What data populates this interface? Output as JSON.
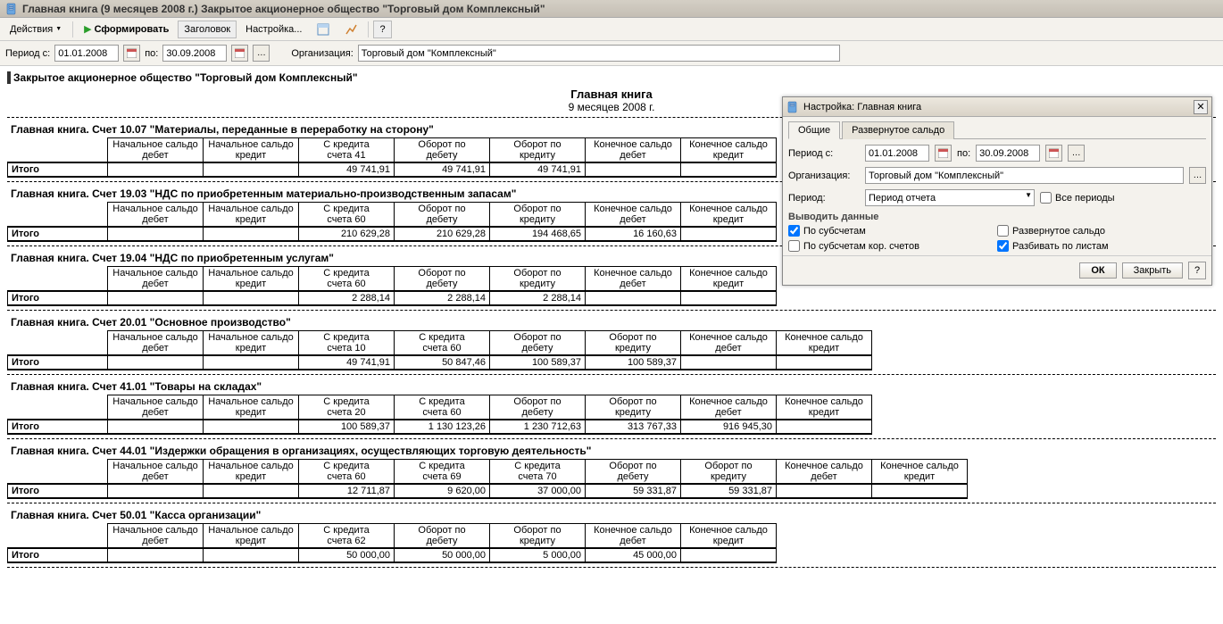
{
  "window": {
    "title": "Главная книга (9 месяцев 2008 г.) Закрытое акционерное общество \"Торговый дом Комплексный\""
  },
  "toolbar": {
    "actions": "Действия",
    "generate": "Сформировать",
    "header": "Заголовок",
    "settings": "Настройка...",
    "help": "?"
  },
  "filter": {
    "period_from_lbl": "Период с:",
    "period_from": "01.01.2008",
    "period_to_lbl": "по:",
    "period_to": "30.09.2008",
    "org_lbl": "Организация:",
    "org": "Торговый дом \"Комплексный\""
  },
  "report": {
    "org_header": "Закрытое акционерное общество \"Торговый дом Комплексный\"",
    "title": "Главная книга",
    "subtitle": "9 месяцев 2008 г.",
    "itog": "Итого",
    "sections": [
      {
        "title": "Главная книга. Счет 10.07 \"Материалы, переданные в переработку на сторону\"",
        "headers": [
          "Начальное сальдо дебет",
          "Начальное сальдо кредит",
          "С кредита счета 41",
          "Оборот по дебету",
          "Оборот по кредиту",
          "Конечное сальдо дебет",
          "Конечное сальдо кредит"
        ],
        "values": [
          "",
          "",
          "49 741,91",
          "49 741,91",
          "49 741,91",
          "",
          ""
        ]
      },
      {
        "title": "Главная книга. Счет 19.03 \"НДС по приобретенным материально-производственным запасам\"",
        "headers": [
          "Начальное сальдо дебет",
          "Начальное сальдо кредит",
          "С кредита счета 60",
          "Оборот по дебету",
          "Оборот по кредиту",
          "Конечное сальдо дебет",
          "Конечное сальдо кредит"
        ],
        "values": [
          "",
          "",
          "210 629,28",
          "210 629,28",
          "194 468,65",
          "16 160,63",
          ""
        ]
      },
      {
        "title": "Главная книга. Счет 19.04 \"НДС по приобретенным услугам\"",
        "headers": [
          "Начальное сальдо дебет",
          "Начальное сальдо кредит",
          "С кредита счета 60",
          "Оборот по дебету",
          "Оборот по кредиту",
          "Конечное сальдо дебет",
          "Конечное сальдо кредит"
        ],
        "values": [
          "",
          "",
          "2 288,14",
          "2 288,14",
          "2 288,14",
          "",
          ""
        ]
      },
      {
        "title": "Главная книга. Счет 20.01 \"Основное производство\"",
        "headers": [
          "Начальное сальдо дебет",
          "Начальное сальдо кредит",
          "С кредита счета 10",
          "С кредита счета 60",
          "Оборот по дебету",
          "Оборот по кредиту",
          "Конечное сальдо дебет",
          "Конечное сальдо кредит"
        ],
        "values": [
          "",
          "",
          "49 741,91",
          "50 847,46",
          "100 589,37",
          "100 589,37",
          "",
          ""
        ]
      },
      {
        "title": "Главная книга. Счет 41.01 \"Товары на складах\"",
        "headers": [
          "Начальное сальдо дебет",
          "Начальное сальдо кредит",
          "С кредита счета 20",
          "С кредита счета 60",
          "Оборот по дебету",
          "Оборот по кредиту",
          "Конечное сальдо дебет",
          "Конечное сальдо кредит"
        ],
        "values": [
          "",
          "",
          "100 589,37",
          "1 130 123,26",
          "1 230 712,63",
          "313 767,33",
          "916 945,30",
          ""
        ]
      },
      {
        "title": "Главная книга. Счет 44.01 \"Издержки обращения в организациях, осуществляющих торговую деятельность\"",
        "headers": [
          "Начальное сальдо дебет",
          "Начальное сальдо кредит",
          "С кредита счета 60",
          "С кредита счета 69",
          "С кредита счета 70",
          "Оборот по дебету",
          "Оборот по кредиту",
          "Конечное сальдо дебет",
          "Конечное сальдо кредит"
        ],
        "values": [
          "",
          "",
          "12 711,87",
          "9 620,00",
          "37 000,00",
          "59 331,87",
          "59 331,87",
          "",
          ""
        ]
      },
      {
        "title": "Главная книга. Счет 50.01 \"Касса организации\"",
        "headers": [
          "Начальное сальдо дебет",
          "Начальное сальдо кредит",
          "С кредита счета 62",
          "Оборот по дебету",
          "Оборот по кредиту",
          "Конечное сальдо дебет",
          "Конечное сальдо кредит"
        ],
        "values": [
          "",
          "",
          "50 000,00",
          "50 000,00",
          "5 000,00",
          "45 000,00",
          ""
        ]
      }
    ]
  },
  "settings": {
    "title": "Настройка: Главная книга",
    "tab_general": "Общие",
    "tab_detailed": "Развернутое сальдо",
    "period_from_lbl": "Период с:",
    "period_from": "01.01.2008",
    "period_to_lbl": "по:",
    "period_to": "30.09.2008",
    "org_lbl": "Организация:",
    "org": "Торговый дом \"Комплексный\"",
    "period_lbl": "Период:",
    "period_sel": "Период отчета",
    "all_periods": "Все периоды",
    "output_hdr": "Выводить данные",
    "by_sub": "По субсчетам",
    "by_sub_cor": "По субсчетам кор. счетов",
    "detailed_saldo": "Развернутое сальдо",
    "split_sheets": "Разбивать по листам",
    "ok": "ОК",
    "close": "Закрыть",
    "help": "?"
  }
}
